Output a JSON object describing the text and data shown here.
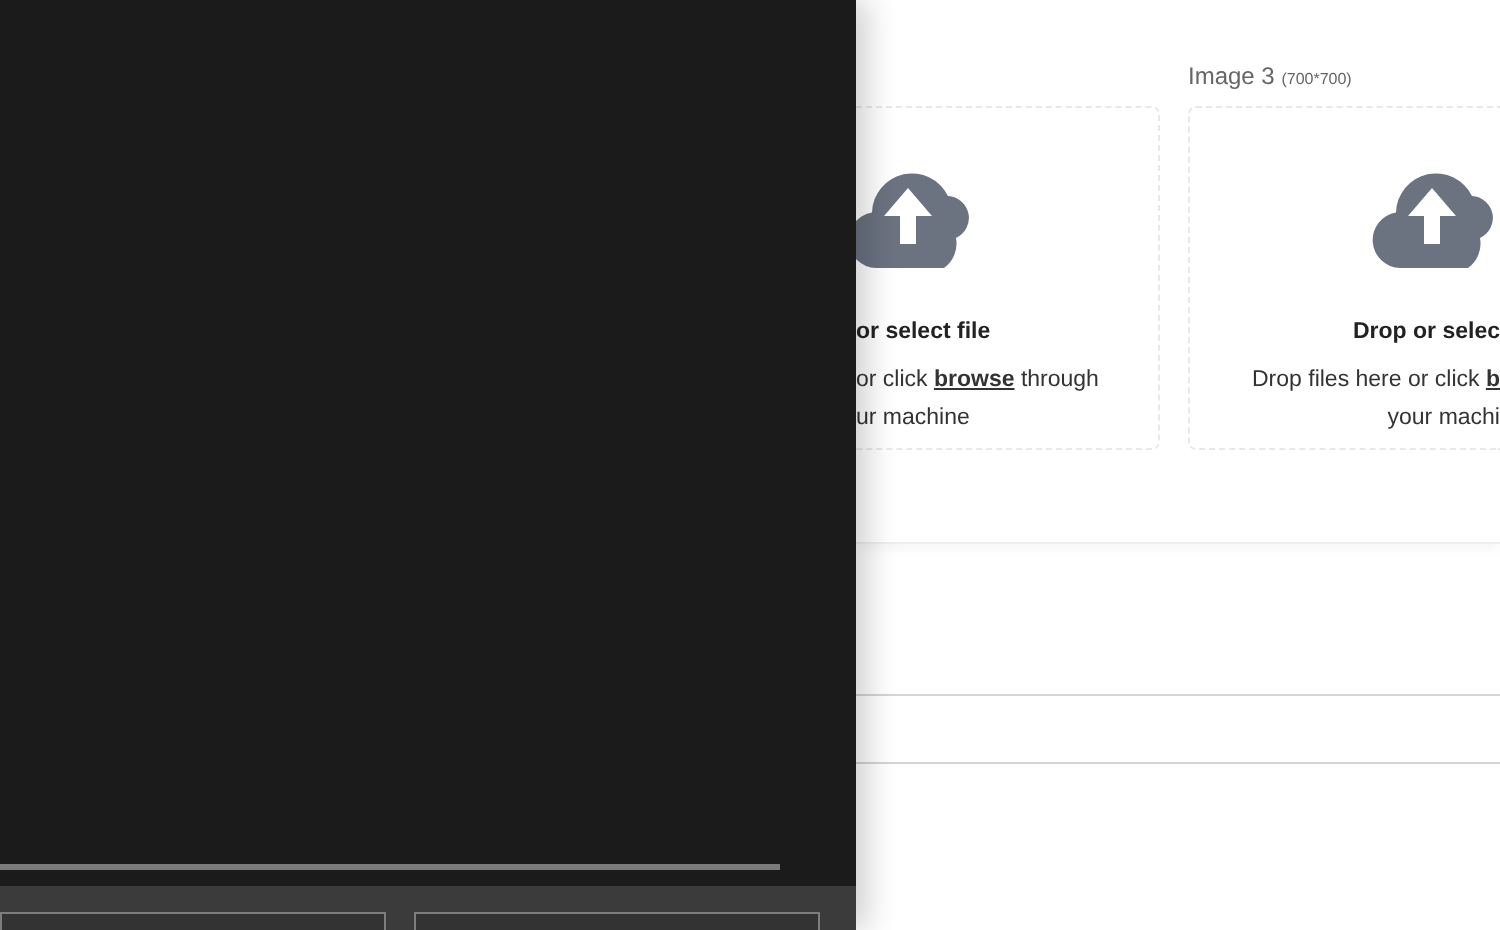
{
  "upload_slots": [
    {
      "kind": "clipped-left",
      "title": "or select file",
      "hint_prefix": "or click ",
      "link": "browse",
      "hint_suffix": " through",
      "hint_line_2": "ur machine"
    },
    {
      "kind": "clipped-right",
      "label": "Image 3",
      "size": "(700*700)",
      "title": "Drop or selec",
      "hint_prefix": "Drop files here or click ",
      "link": "b",
      "hint_line_2": "your machi"
    }
  ]
}
